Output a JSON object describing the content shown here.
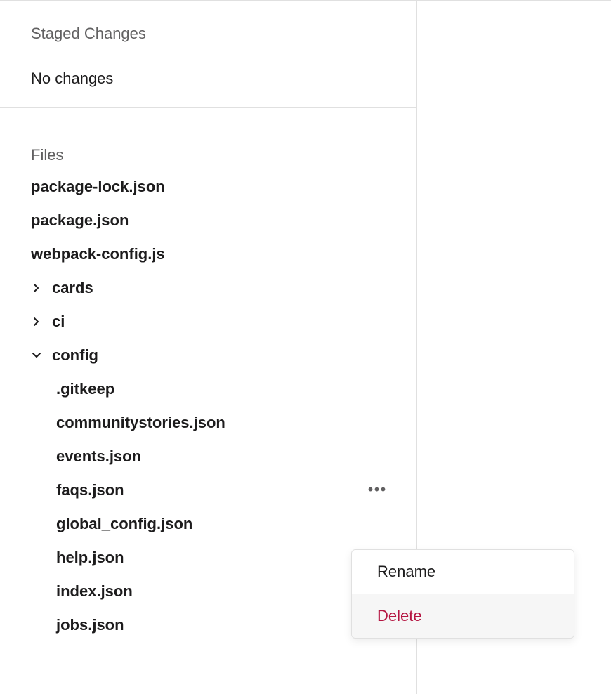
{
  "sections": {
    "staged_changes": {
      "title": "Staged Changes",
      "empty_text": "No changes"
    },
    "files": {
      "title": "Files",
      "items": [
        {
          "name": "package-lock.json",
          "type": "file"
        },
        {
          "name": "package.json",
          "type": "file"
        },
        {
          "name": "webpack-config.js",
          "type": "file"
        },
        {
          "name": "cards",
          "type": "folder",
          "expanded": false
        },
        {
          "name": "ci",
          "type": "folder",
          "expanded": false
        },
        {
          "name": "config",
          "type": "folder",
          "expanded": true,
          "children": [
            {
              "name": ".gitkeep"
            },
            {
              "name": "communitystories.json"
            },
            {
              "name": "events.json"
            },
            {
              "name": "faqs.json",
              "active_menu": true
            },
            {
              "name": "global_config.json"
            },
            {
              "name": "help.json"
            },
            {
              "name": "index.json"
            },
            {
              "name": "jobs.json"
            }
          ]
        }
      ]
    }
  },
  "context_menu": {
    "rename": "Rename",
    "delete": "Delete"
  }
}
